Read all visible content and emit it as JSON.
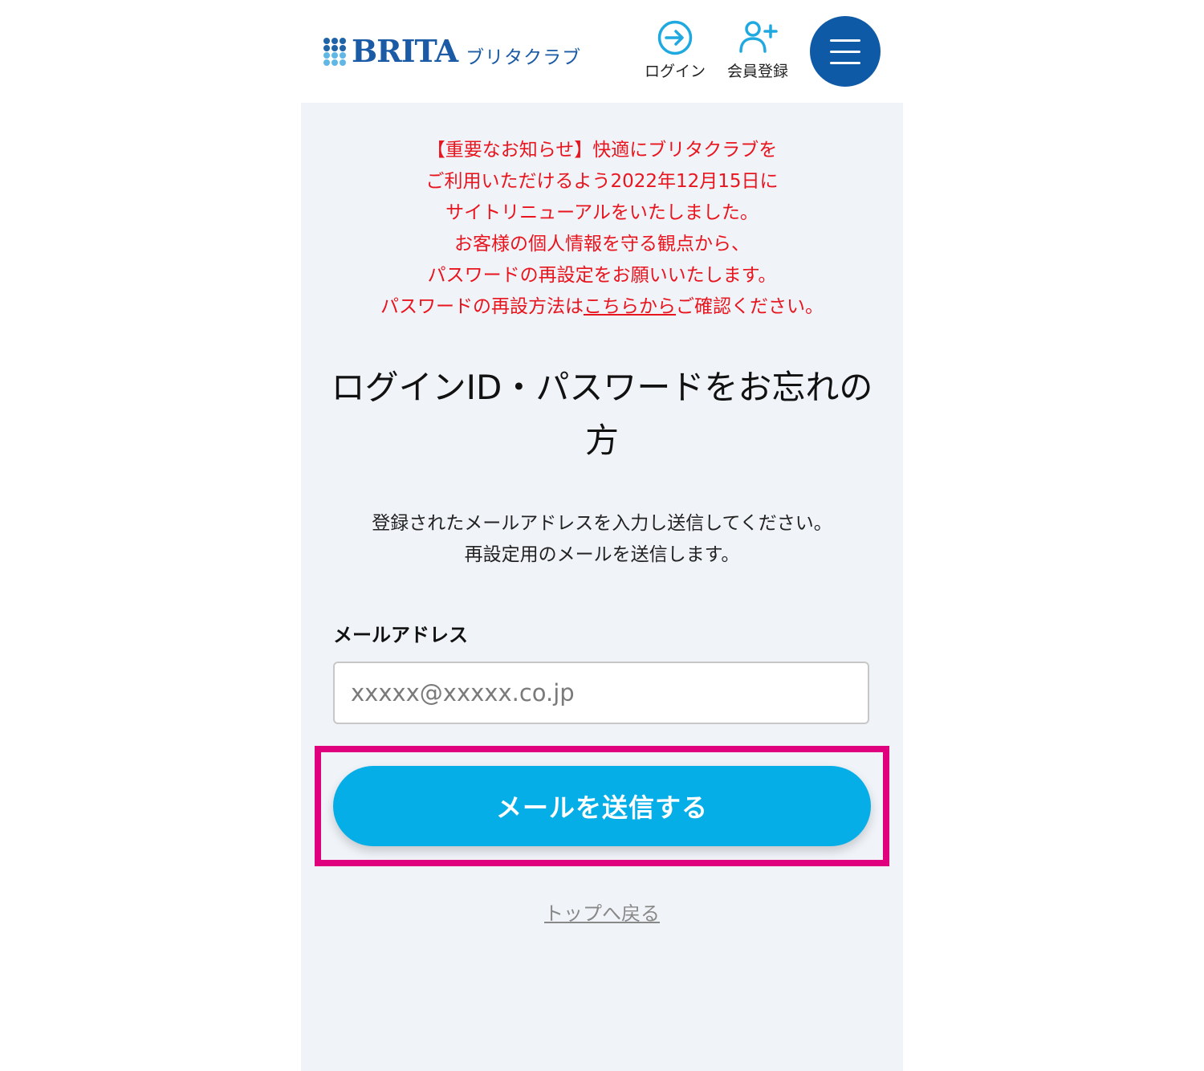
{
  "header": {
    "logo_text": "BRITA",
    "logo_sub": "ブリタクラブ",
    "login_label": "ログイン",
    "register_label": "会員登録",
    "brand_color": "#1b5ba6",
    "accent_color": "#1fa9e0",
    "menu_button_color": "#0e5aa7",
    "icons": {
      "login": "login-arrow-icon",
      "register": "user-plus-icon",
      "menu": "hamburger-menu-icon"
    }
  },
  "notice": {
    "color": "#e8141e",
    "line1": "【重要なお知らせ】快適にブリタクラブを",
    "line2": "ご利用いただけるよう2022年12月15日に",
    "line3": "サイトリニューアルをいたしました。",
    "line4": "お客様の個人情報を守る観点から、",
    "line5": "パスワードの再設定をお願いいたします。",
    "line6_prefix": "パスワードの再設方法は",
    "line6_link": "こちらから",
    "line6_suffix": "ご確認ください。"
  },
  "page": {
    "title": "ログインID・パスワードをお忘れの方",
    "desc_line1": "登録されたメールアドレスを入力し送信してください。",
    "desc_line2": "再設定用のメールを送信します。"
  },
  "form": {
    "email_label": "メールアドレス",
    "email_placeholder": "xxxxx@xxxxx.co.jp",
    "email_value": "",
    "submit_label": "メールを送信する",
    "submit_color": "#06aee8",
    "highlight_color": "#e0007e"
  },
  "footer": {
    "back_link": "トップへ戻る"
  }
}
